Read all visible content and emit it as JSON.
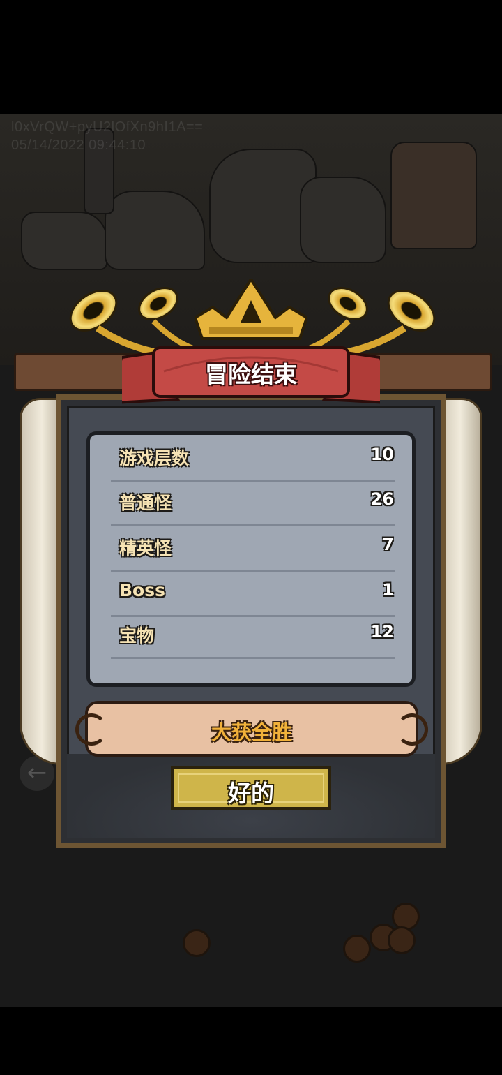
{
  "watermark": {
    "line1": "l0xVrQW+pyU2lOfXn9hI1A==",
    "line2": "05/14/2022 09:44:10"
  },
  "dialog": {
    "title": "冒险结束",
    "stats": [
      {
        "label": "游戏层数",
        "value": "10"
      },
      {
        "label": "普通怪",
        "value": "26"
      },
      {
        "label": "精英怪",
        "value": "7"
      },
      {
        "label": "Boss",
        "value": "1"
      },
      {
        "label": "宝物",
        "value": "12"
      }
    ],
    "result": "大获全胜",
    "ok_label": "好的"
  },
  "colors": {
    "banner_red": "#c44a46",
    "gold": "#d8a630",
    "stats_panel": "#9fa7b3",
    "result_text": "#f1b13a",
    "button": "#cfb54a"
  },
  "icons": [
    "horn-icon",
    "crown-icon",
    "back-arrow-icon",
    "coin-icon"
  ]
}
